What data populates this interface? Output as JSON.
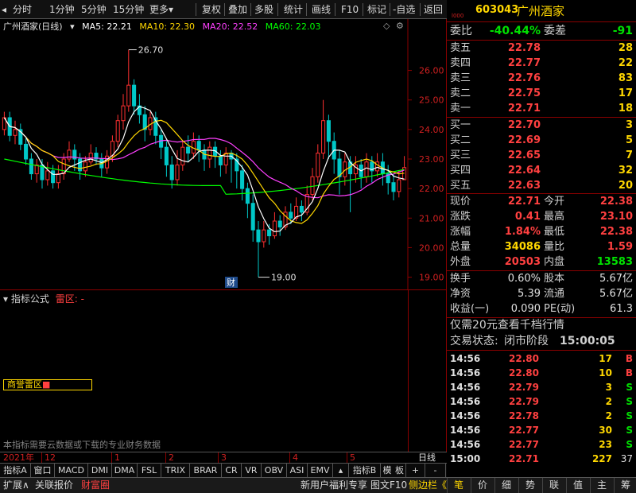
{
  "toolbar": {
    "items": [
      "分时",
      "1分钟",
      "5分钟",
      "15分钟",
      "更多",
      "复权",
      "叠加",
      "多股",
      "统计",
      "画线",
      "F10",
      "标记",
      "-自选",
      "返回"
    ]
  },
  "quote_header": {
    "code": "603043",
    "name": "广州酒家",
    "level_badge": "l000"
  },
  "chart": {
    "stock_label": "广州酒家(日线)",
    "ma5": "MA5: 22.21",
    "ma10": "MA10: 22.30",
    "ma20": "MA20: 22.52",
    "ma60": "MA60: 22.03",
    "high_label": "26.70",
    "low_label": "19.00",
    "fin_marker": "财",
    "axis_ticks": [
      "26.00",
      "25.00",
      "24.00",
      "23.00",
      "22.00",
      "21.00",
      "20.00",
      "19.00"
    ],
    "colors": {
      "up": "#ff3030",
      "down": "#00c8c8",
      "ma5": "#ffffff",
      "ma10": "#ffd700",
      "ma20": "#ff40ff",
      "ma60": "#00ff00"
    }
  },
  "chart_data": {
    "type": "candlestick",
    "yaxis_ticks": [
      26.0,
      25.0,
      24.0,
      23.0,
      22.0,
      21.0,
      20.0,
      19.0
    ],
    "ylim": [
      18.8,
      27.2
    ],
    "series": [
      {
        "name": "MA5",
        "value": 22.21
      },
      {
        "name": "MA10",
        "value": 22.3
      },
      {
        "name": "MA20",
        "value": 22.52
      },
      {
        "name": "MA60",
        "value": 22.03
      }
    ],
    "annotations": [
      {
        "text": "26.70",
        "value": 26.7
      },
      {
        "text": "19.00",
        "value": 19.0
      }
    ],
    "candles": [
      [
        24.0,
        24.4,
        24.6,
        23.8
      ],
      [
        24.4,
        23.8,
        24.6,
        23.6
      ],
      [
        23.8,
        24.0,
        24.3,
        23.5
      ],
      [
        24.0,
        23.5,
        24.2,
        23.3
      ],
      [
        23.5,
        23.0,
        23.7,
        22.8
      ],
      [
        23.0,
        22.5,
        23.2,
        22.3
      ],
      [
        22.5,
        22.8,
        23.0,
        22.2
      ],
      [
        22.8,
        22.3,
        23.0,
        22.0
      ],
      [
        22.3,
        22.6,
        22.9,
        22.1
      ],
      [
        22.6,
        22.2,
        22.8,
        22.0
      ],
      [
        22.2,
        22.5,
        22.8,
        22.0
      ],
      [
        22.5,
        23.0,
        23.2,
        22.3
      ],
      [
        23.0,
        23.3,
        23.6,
        22.9
      ],
      [
        23.3,
        23.0,
        23.5,
        22.6
      ],
      [
        23.0,
        22.6,
        23.2,
        22.3
      ],
      [
        22.6,
        22.9,
        23.1,
        22.4
      ],
      [
        22.9,
        23.2,
        23.5,
        22.8
      ],
      [
        23.2,
        23.0,
        23.4,
        22.8
      ],
      [
        23.0,
        22.7,
        23.2,
        22.4
      ],
      [
        22.7,
        23.1,
        23.3,
        22.5
      ],
      [
        23.1,
        23.6,
        23.8,
        22.9
      ],
      [
        23.6,
        24.3,
        24.5,
        23.4
      ],
      [
        24.3,
        24.8,
        25.2,
        24.0
      ],
      [
        24.8,
        25.5,
        26.7,
        24.6
      ],
      [
        25.5,
        24.8,
        25.7,
        24.5
      ],
      [
        24.8,
        24.5,
        25.2,
        24.2
      ],
      [
        24.5,
        24.0,
        24.8,
        23.6
      ],
      [
        24.0,
        24.4,
        24.6,
        23.8
      ],
      [
        24.4,
        23.8,
        24.6,
        23.5
      ],
      [
        23.8,
        23.4,
        24.0,
        23.0
      ],
      [
        23.4,
        22.8,
        23.6,
        22.4
      ],
      [
        22.8,
        22.3,
        23.1,
        22.0
      ],
      [
        22.3,
        22.8,
        23.3,
        22.1
      ],
      [
        22.8,
        23.4,
        23.6,
        22.6
      ],
      [
        23.4,
        23.2,
        23.8,
        22.9
      ],
      [
        23.2,
        23.6,
        23.9,
        23.0
      ],
      [
        23.6,
        23.3,
        23.8,
        22.9
      ],
      [
        23.3,
        23.0,
        23.5,
        22.6
      ],
      [
        23.0,
        23.4,
        23.6,
        22.7
      ],
      [
        23.4,
        23.1,
        23.6,
        22.7
      ],
      [
        23.1,
        22.8,
        23.3,
        22.4
      ],
      [
        22.8,
        23.2,
        23.4,
        22.5
      ],
      [
        23.2,
        23.0,
        23.3,
        22.2
      ],
      [
        23.0,
        22.6,
        23.2,
        22.0
      ],
      [
        22.6,
        22.0,
        22.8,
        21.6
      ],
      [
        22.0,
        21.5,
        22.2,
        21.0
      ],
      [
        21.5,
        20.6,
        21.8,
        20.2
      ],
      [
        20.6,
        20.2,
        20.9,
        19.0
      ],
      [
        20.2,
        20.6,
        20.9,
        20.0
      ],
      [
        20.6,
        20.4,
        20.8,
        20.1
      ],
      [
        20.4,
        20.9,
        21.2,
        20.3
      ],
      [
        20.9,
        20.7,
        21.1,
        20.4
      ],
      [
        20.7,
        21.2,
        21.4,
        20.6
      ],
      [
        21.2,
        21.0,
        21.5,
        20.8
      ],
      [
        21.0,
        21.4,
        21.7,
        20.9
      ],
      [
        21.4,
        21.2,
        21.6,
        20.9
      ],
      [
        21.2,
        21.8,
        22.1,
        21.1
      ],
      [
        21.8,
        22.4,
        22.7,
        21.6
      ],
      [
        22.4,
        23.2,
        23.5,
        22.2
      ],
      [
        23.2,
        24.3,
        25.0,
        23.0
      ],
      [
        24.3,
        23.6,
        24.5,
        23.0
      ],
      [
        23.6,
        23.0,
        23.9,
        22.5
      ],
      [
        23.0,
        22.4,
        23.3,
        21.8
      ],
      [
        22.4,
        22.9,
        23.2,
        22.1
      ],
      [
        22.9,
        22.5,
        23.1,
        21.2
      ],
      [
        22.5,
        22.8,
        23.1,
        22.2
      ],
      [
        22.8,
        22.4,
        23.0,
        22.0
      ],
      [
        22.4,
        22.9,
        23.2,
        22.2
      ],
      [
        22.9,
        22.6,
        23.1,
        22.2
      ],
      [
        22.6,
        22.9,
        23.2,
        22.4
      ],
      [
        22.9,
        22.5,
        23.2,
        22.1
      ],
      [
        22.5,
        22.2,
        22.8,
        21.8
      ],
      [
        22.2,
        21.9,
        22.5,
        21.6
      ],
      [
        21.9,
        22.3,
        22.6,
        21.7
      ],
      [
        22.3,
        22.71,
        23.1,
        22.38
      ]
    ]
  },
  "indicator": {
    "title": "指标公式",
    "name": "雷区",
    "suffix": "-",
    "box_label": "商誉雷区",
    "note": "本指标需要云数据或下载的专业财务数据"
  },
  "date_row": {
    "labels": [
      "2021年",
      "12",
      "1",
      "2",
      "3",
      "4",
      "5"
    ],
    "right_label": "日线"
  },
  "ind_tabs": [
    "指标A",
    "窗口",
    "MACD",
    "DMI",
    "DMA",
    "FSL",
    "TRIX",
    "BRAR",
    "CR",
    "VR",
    "OBV",
    "ASI",
    "EMV",
    "",
    "指标B",
    "模",
    "板",
    "+",
    "-"
  ],
  "status_bar": {
    "left": [
      "扩展∧",
      "关联报价",
      "财富圈"
    ],
    "right": [
      "新用户福利专享",
      "图文F10",
      "侧边栏《"
    ]
  },
  "bottom_tabs": [
    "笔",
    "价",
    "细",
    "势",
    "联",
    "值",
    "主",
    "筹"
  ],
  "quote": {
    "wei_bi_label": "委比",
    "wei_bi": "-40.44%",
    "wei_cha_label": "委差",
    "wei_cha": "-91",
    "sell": [
      {
        "label": "卖五",
        "price": "22.78",
        "vol": "28"
      },
      {
        "label": "卖四",
        "price": "22.77",
        "vol": "22"
      },
      {
        "label": "卖三",
        "price": "22.76",
        "vol": "83"
      },
      {
        "label": "卖二",
        "price": "22.75",
        "vol": "17"
      },
      {
        "label": "卖一",
        "price": "22.71",
        "vol": "18"
      }
    ],
    "buy": [
      {
        "label": "买一",
        "price": "22.70",
        "vol": "3"
      },
      {
        "label": "买二",
        "price": "22.69",
        "vol": "5"
      },
      {
        "label": "买三",
        "price": "22.65",
        "vol": "7"
      },
      {
        "label": "买四",
        "price": "22.64",
        "vol": "32"
      },
      {
        "label": "买五",
        "price": "22.63",
        "vol": "20"
      }
    ],
    "stats": [
      {
        "l1": "现价",
        "v1": "22.71",
        "c1": "red",
        "l2": "今开",
        "v2": "22.38",
        "c2": "red"
      },
      {
        "l1": "涨跌",
        "v1": "0.41",
        "c1": "red",
        "l2": "最高",
        "v2": "23.10",
        "c2": "red"
      },
      {
        "l1": "涨幅",
        "v1": "1.84%",
        "c1": "red",
        "l2": "最低",
        "v2": "22.38",
        "c2": "red"
      },
      {
        "l1": "总量",
        "v1": "34086",
        "c1": "yellow",
        "l2": "量比",
        "v2": "1.59",
        "c2": "red"
      },
      {
        "l1": "外盘",
        "v1": "20503",
        "c1": "red",
        "l2": "内盘",
        "v2": "13583",
        "c2": "green"
      }
    ],
    "fin": [
      {
        "l1": "换手",
        "v1": "0.60%",
        "l2": "股本",
        "v2": "5.67亿"
      },
      {
        "l1": "净资",
        "v1": "5.39",
        "l2": "流通",
        "v2": "5.67亿"
      },
      {
        "l1": "收益(一)",
        "v1": "0.090",
        "l2": "PE(动)",
        "v2": "61.3"
      }
    ],
    "promo": "仅需20元查看千档行情",
    "trade_status_label": "交易状态:",
    "trade_status": "闭市阶段",
    "trade_time": "15:00:05",
    "ticks": [
      {
        "t": "14:56",
        "p": "22.80",
        "v": "17",
        "d": "B",
        "dc": "red"
      },
      {
        "t": "14:56",
        "p": "22.80",
        "v": "10",
        "d": "B",
        "dc": "red"
      },
      {
        "t": "14:56",
        "p": "22.79",
        "v": "3",
        "d": "S",
        "dc": "green"
      },
      {
        "t": "14:56",
        "p": "22.79",
        "v": "2",
        "d": "S",
        "dc": "green"
      },
      {
        "t": "14:56",
        "p": "22.78",
        "v": "2",
        "d": "S",
        "dc": "green"
      },
      {
        "t": "14:56",
        "p": "22.77",
        "v": "30",
        "d": "S",
        "dc": "green"
      },
      {
        "t": "14:56",
        "p": "22.77",
        "v": "23",
        "d": "S",
        "dc": "green"
      },
      {
        "t": "15:00",
        "p": "22.71",
        "v": "227",
        "d": "37",
        "dc": "white"
      }
    ]
  }
}
